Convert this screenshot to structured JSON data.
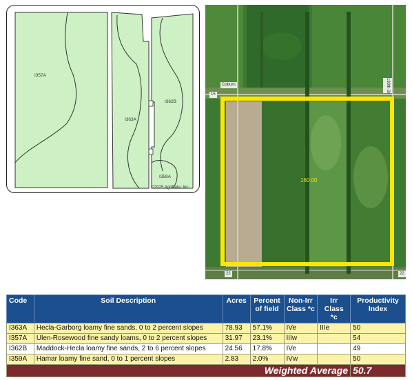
{
  "soil_map": {
    "labels": {
      "i357a": "I357A",
      "i363a": "I363A",
      "i362b": "I362B",
      "i359a": "I359A"
    },
    "credit": "©2025 AgriData, Inc."
  },
  "aerial": {
    "road_labels": {
      "top_left": "Coburn",
      "top_right": "130th St",
      "left_mid": "15",
      "bottom_left": "22",
      "bottom_right": "22"
    },
    "acre_label": "160.00",
    "boundary_color": "#ffe600"
  },
  "table": {
    "headers": {
      "code": "Code",
      "soil_description": "Soil Description",
      "acres": "Acres",
      "percent_of_field_line1": "Percent",
      "percent_of_field_line2": "of field",
      "non_irr_class_line1": "Non-Irr",
      "non_irr_class_line2": "Class *c",
      "irr_class_line1": "Irr Class",
      "irr_class_line2": "*c",
      "productivity_index_line1": "Productivity",
      "productivity_index_line2": "Index"
    },
    "rows": [
      {
        "code": "I363A",
        "description": "Hecla-Garborg loamy fine sands, 0 to 2 percent slopes",
        "acres": "78.93",
        "percent": "57.1%",
        "non_irr": "IVe",
        "irr": "IIIe",
        "pi": "50"
      },
      {
        "code": "I357A",
        "description": "Ulen-Rosewood fine sandy loams, 0 to 2 percent slopes",
        "acres": "31.97",
        "percent": "23.1%",
        "non_irr": "IIIw",
        "irr": "",
        "pi": "54"
      },
      {
        "code": "I362B",
        "description": "Maddock-Hecla loamy fine sands, 2 to 6 percent slopes",
        "acres": "24.56",
        "percent": "17.8%",
        "non_irr": "IVe",
        "irr": "",
        "pi": "49"
      },
      {
        "code": "I359A",
        "description": "Hamar loamy fine sand, 0 to 1 percent slopes",
        "acres": "2.83",
        "percent": "2.0%",
        "non_irr": "IVw",
        "irr": "",
        "pi": "50"
      }
    ],
    "weighted_average_label": "Weighted Average",
    "weighted_average_value": "50.7"
  },
  "colors": {
    "header_blue": "#1c4f8e",
    "row_yellow": "#fbf3a8",
    "footer_maroon": "#7c2a2c",
    "soil_fill": "#cdf0c4"
  }
}
